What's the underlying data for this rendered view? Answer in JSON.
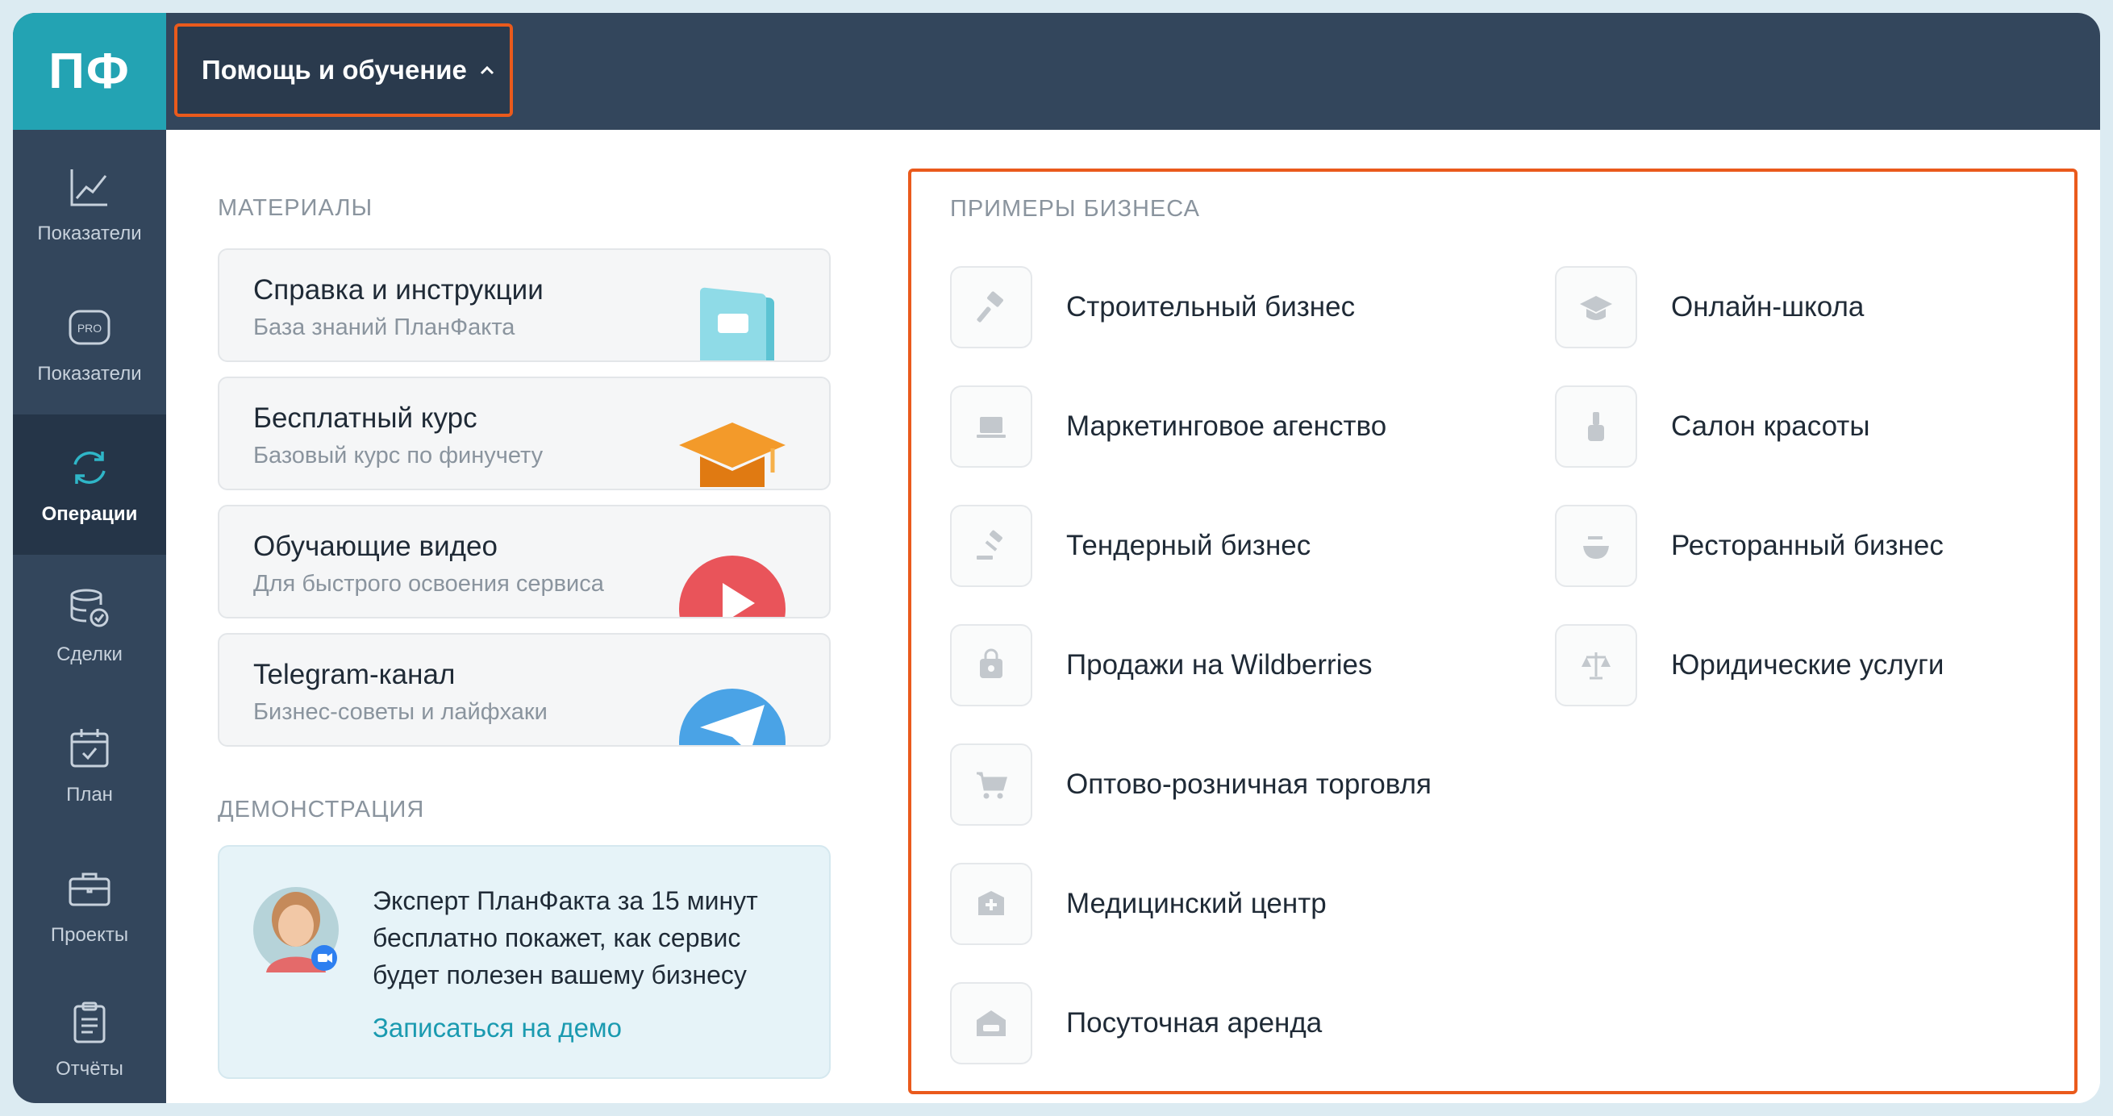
{
  "app": {
    "logo": "ПФ"
  },
  "sidebar": {
    "items": [
      {
        "label": "Показатели",
        "icon": "line-chart-icon",
        "active": false
      },
      {
        "label": "Показатели",
        "icon": "pro-badge-icon",
        "active": false
      },
      {
        "label": "Операции",
        "icon": "sync-arrows-icon",
        "active": true
      },
      {
        "label": "Сделки",
        "icon": "database-check-icon",
        "active": false
      },
      {
        "label": "План",
        "icon": "calendar-check-icon",
        "active": false
      },
      {
        "label": "Проекты",
        "icon": "briefcase-icon",
        "active": false
      },
      {
        "label": "Отчёты",
        "icon": "clipboard-icon",
        "active": false
      }
    ]
  },
  "topbar": {
    "help_label": "Помощь и обучение"
  },
  "materials": {
    "title": "МАТЕРИАЛЫ",
    "cards": [
      {
        "title": "Справка и инструкции",
        "subtitle": "База знаний ПланФакта",
        "icon": "book-icon"
      },
      {
        "title": "Бесплатный курс",
        "subtitle": "Базовый курс по финучету",
        "icon": "graduation-cap-icon"
      },
      {
        "title": "Обучающие видео",
        "subtitle": "Для быстрого освоения сервиса",
        "icon": "play-icon"
      },
      {
        "title": "Telegram-канал",
        "subtitle": "Бизнес-советы и лайфхаки",
        "icon": "telegram-icon"
      }
    ]
  },
  "demo": {
    "title": "ДЕМОНСТРАЦИЯ",
    "text": "Эксперт ПланФакта за 15 минут бесплатно покажет, как сервис будет полезен вашему бизнесу",
    "link": "Записаться на демо"
  },
  "business": {
    "title": "ПРИМЕРЫ БИЗНЕСА",
    "left": [
      {
        "label": "Строительный бизнес",
        "icon": "hammer-icon"
      },
      {
        "label": "Маркетинговое агенство",
        "icon": "laptop-icon"
      },
      {
        "label": "Тендерный бизнес",
        "icon": "gavel-icon"
      },
      {
        "label": "Продажи на Wildberries",
        "icon": "shopping-bag-icon"
      },
      {
        "label": "Оптово-розничная торговля",
        "icon": "cart-icon"
      },
      {
        "label": "Медицинский центр",
        "icon": "medical-icon"
      },
      {
        "label": "Посуточная аренда",
        "icon": "bed-icon"
      }
    ],
    "right": [
      {
        "label": "Онлайн-школа",
        "icon": "graduation-icon"
      },
      {
        "label": "Салон красоты",
        "icon": "nail-polish-icon"
      },
      {
        "label": "Ресторанный бизнес",
        "icon": "dish-icon"
      },
      {
        "label": "Юридические услуги",
        "icon": "scales-icon"
      }
    ]
  },
  "colors": {
    "accent_border": "#ea5a1c",
    "sidebar": "#33465c",
    "logo_bg": "#23a3b3",
    "link": "#1a9ab0"
  }
}
